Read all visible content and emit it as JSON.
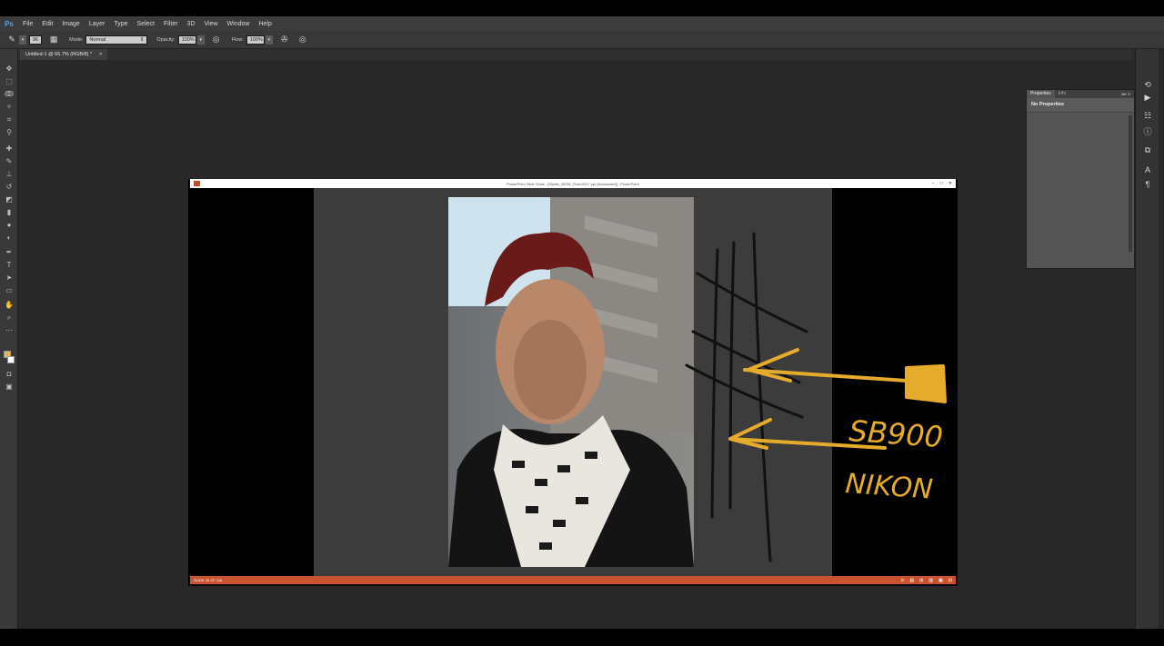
{
  "menu": {
    "logo": "Ps",
    "items": [
      "File",
      "Edit",
      "Image",
      "Layer",
      "Type",
      "Select",
      "Filter",
      "3D",
      "View",
      "Window",
      "Help"
    ]
  },
  "options": {
    "brush_size": "96",
    "mode_label": "Mode:",
    "mode_value": "Normal",
    "opacity_label": "Opacity:",
    "opacity_value": "100%",
    "flow_label": "Flow:",
    "flow_value": "100%"
  },
  "document_tab": {
    "title": "Untitled-1 @ 66.7% (RGB/8) *",
    "close": "×"
  },
  "panel": {
    "tabs": [
      "Properties",
      "Info"
    ],
    "heading": "No Properties"
  },
  "powerpoint": {
    "title": "PowerPoint Slide Show - [Mystic_WOW_Flash2017.ppt [Autosaved]] - PowerPoint",
    "status": "SLIDE 39 OF 116"
  },
  "slide_annotations": {
    "line1": "SB900",
    "line2": "NIKON"
  },
  "colors": {
    "foreground": "#e6b84a",
    "background": "#ffffff",
    "ink_yellow": "#e5ac2b",
    "ink_black": "#111111",
    "status_bar": "#c8532e"
  }
}
